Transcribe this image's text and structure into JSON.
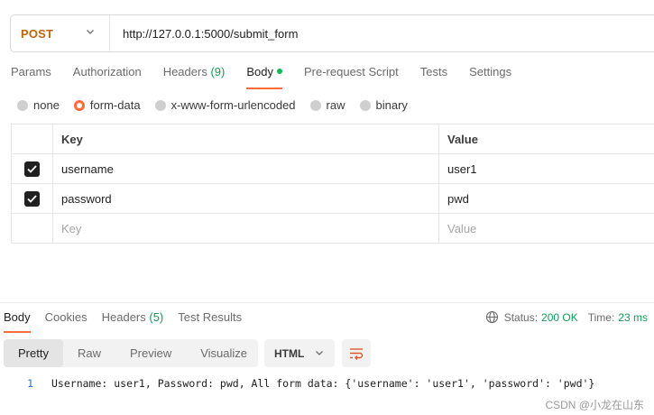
{
  "request": {
    "method": "POST",
    "url": "http://127.0.0.1:5000/submit_form"
  },
  "request_tabs": [
    {
      "label": "Params",
      "count": ""
    },
    {
      "label": "Authorization",
      "count": ""
    },
    {
      "label": "Headers",
      "count": "(9)"
    },
    {
      "label": "Body",
      "count": ""
    },
    {
      "label": "Pre-request Script",
      "count": ""
    },
    {
      "label": "Tests",
      "count": ""
    },
    {
      "label": "Settings",
      "count": ""
    }
  ],
  "body_types": [
    "none",
    "form-data",
    "x-www-form-urlencoded",
    "raw",
    "binary"
  ],
  "body_type_selected": "form-data",
  "form_table": {
    "headers": {
      "key": "Key",
      "value": "Value"
    },
    "rows": [
      {
        "key": "username",
        "value": "user1",
        "checked": true
      },
      {
        "key": "password",
        "value": "pwd",
        "checked": true
      }
    ],
    "placeholder": {
      "key": "Key",
      "value": "Value"
    }
  },
  "response": {
    "tabs": [
      {
        "label": "Body",
        "count": ""
      },
      {
        "label": "Cookies",
        "count": ""
      },
      {
        "label": "Headers",
        "count": "(5)"
      },
      {
        "label": "Test Results",
        "count": ""
      }
    ],
    "status_label": "Status:",
    "status_value": "200 OK",
    "time_label": "Time:",
    "time_value": "23 ms",
    "views": [
      "Pretty",
      "Raw",
      "Preview",
      "Visualize"
    ],
    "view_selected": "Pretty",
    "format": "HTML",
    "lines": [
      {
        "num": "1",
        "text": "Username: user1, Password: pwd, All form data: {'username': 'user1', 'password': 'pwd'}"
      }
    ]
  },
  "watermark": "CSDN @小龙在山东",
  "colors": {
    "accent": "#ff6c37",
    "method": "#c0650f",
    "success": "#0f9d58"
  }
}
